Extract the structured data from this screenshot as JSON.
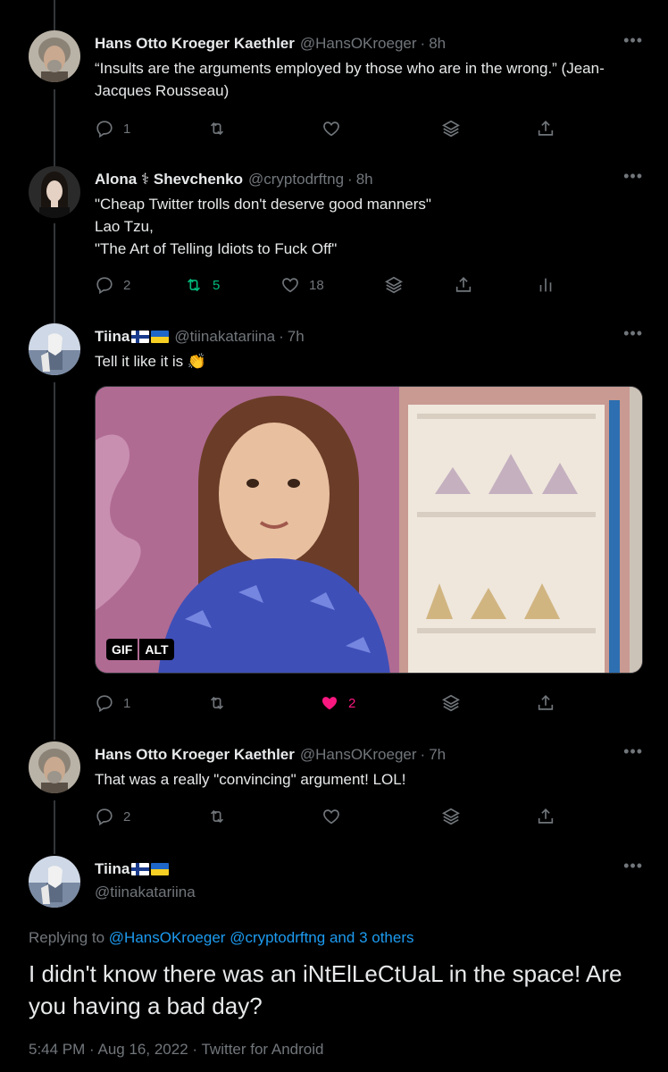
{
  "tweets": [
    {
      "name": "Hans Otto Kroeger Kaethler",
      "handle": "@HansOKroeger",
      "time": "8h",
      "text": "“Insults are the arguments employed by those who are in the wrong.” (Jean-Jacques Rousseau)",
      "replies": "1",
      "retweets": "",
      "likes": ""
    },
    {
      "name": "Alona ⚕ Shevchenko",
      "handle": "@cryptodrftng",
      "time": "8h",
      "text": "\"Cheap Twitter trolls don't deserve good manners\"\nLao Tzu,\n\"The Art of Telling Idiots to Fuck Off\"",
      "replies": "2",
      "retweets": "5",
      "likes": "18"
    },
    {
      "name": "Tiina",
      "handle": "@tiinakatariina",
      "time": "7h",
      "text": "Tell it like it is 👏",
      "replies": "1",
      "retweets": "",
      "likes": "2",
      "gif_badge": "GIF",
      "alt_badge": "ALT"
    },
    {
      "name": "Hans Otto Kroeger Kaethler",
      "handle": "@HansOKroeger",
      "time": "7h",
      "text": "That was a really \"convincing\" argument! LOL!",
      "replies": "2",
      "retweets": "",
      "likes": ""
    }
  ],
  "main_tweet": {
    "name": "Tiina",
    "handle": "@tiinakatariina",
    "replying_label": "Replying to",
    "replying_to_1": "@HansOKroeger",
    "replying_to_2": "@cryptodrftng",
    "replying_and": "and",
    "replying_others": "3 others",
    "text": "I didn't know there was an iNtElLeCtUaL in the space! Are you having a bad day?",
    "time": "5:44 PM",
    "date": "Aug 16, 2022",
    "source": "Twitter for Android"
  },
  "more_icon": "more-horizontal-icon",
  "colors": {
    "background": "#000000",
    "text_primary": "#e7e9ea",
    "text_secondary": "#71767b",
    "link": "#1d9bf0",
    "retweet_active": "#00ba7c",
    "like_active": "#f91880"
  }
}
